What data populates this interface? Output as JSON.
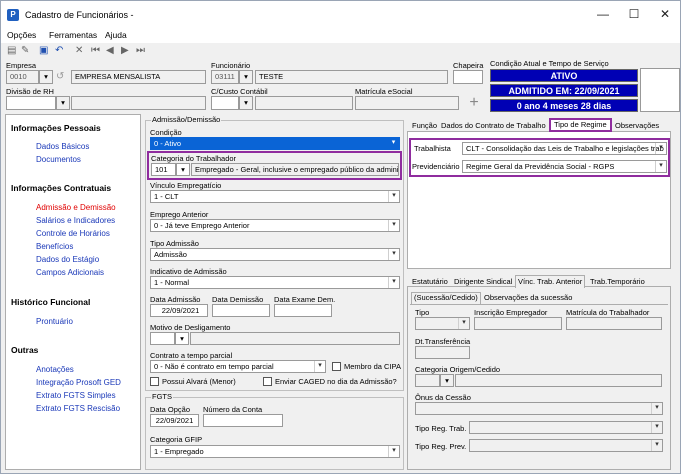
{
  "window": {
    "title": "Cadastro de Funcionários -",
    "min": "—",
    "max": "☐",
    "close": "✕"
  },
  "menu": [
    "Opções",
    "Ferramentas",
    "Ajuda"
  ],
  "top": {
    "empresa_label": "Empresa",
    "empresa_code": "0010",
    "empresa_name": "EMPRESA MENSALISTA",
    "funcionario_label": "Funcionário",
    "funcionario_code": "03111",
    "funcionario_name": "TESTE",
    "chapeira_label": "Chapeira",
    "condicao_label": "Condição Atual e Tempo de Serviço",
    "status1": "ATIVO",
    "status2": "ADMITIDO EM: 22/09/2021",
    "status3": "0 ano 4 meses 28 dias",
    "divisao_label": "Divisão de RH",
    "ccusto_label": "C/Custo Contábil",
    "matricula_label": "Matrícula eSocial"
  },
  "left": {
    "h1": "Informações Pessoais",
    "items1": [
      "Dados Básicos",
      "Documentos"
    ],
    "h2": "Informações Contratuais",
    "items2": [
      "Admissão e Demissão",
      "Salários e Indicadores",
      "Controle de Horários",
      "Benefícios",
      "Dados do Estágio",
      "Campos Adicionais"
    ],
    "h3": "Histórico Funcional",
    "items3": [
      "Prontuário"
    ],
    "h4": "Outras",
    "items4": [
      "Anotações",
      "Integração Prosoft GED",
      "Extrato FGTS Simples",
      "Extrato FGTS Rescisão"
    ]
  },
  "adm": {
    "group": "Admissão/Demissão",
    "condicao_label": "Condição",
    "condicao": "0 - Ativo",
    "categoria_label": "Categoria do Trabalhador",
    "categoria_code": "101",
    "categoria_desc": "Empregado - Geral, inclusive o empregado público da administ",
    "vinculo_label": "Vínculo Empregatício",
    "vinculo": "1 - CLT",
    "emprego_label": "Emprego Anterior",
    "emprego": "0 - Já teve Emprego Anterior",
    "tipoadm_label": "Tipo Admissão",
    "tipoadm": "Admissão",
    "indicativo_label": "Indicativo de Admissão",
    "indicativo": "1 - Normal",
    "data_adm_label": "Data Admissão",
    "data_adm": "22/09/2021",
    "data_dem_label": "Data Demissão",
    "data_exame_label": "Data Exame Dem.",
    "motivo_label": "Motivo de Desligamento",
    "contrato_label": "Contrato a tempo parcial",
    "contrato": "0 - Não é contrato em tempo parcial",
    "membro_cipa": "Membro da CIPA",
    "possui_alvara": "Possui Alvará (Menor)",
    "enviar_caged": "Enviar CAGED no dia da Admissão?"
  },
  "fgts": {
    "group": "FGTS",
    "data_opcao_label": "Data Opção",
    "data_opcao": "22/09/2021",
    "numero_conta_label": "Número da Conta",
    "categoria_gfip_label": "Categoria GFIP",
    "categoria_gfip": "1 - Empregado"
  },
  "tabs1": [
    "Função",
    "Dados do Contrato de Trabalho",
    "Tipo de Regime",
    "Observações"
  ],
  "regime": {
    "trab_label": "Trabalhista",
    "trab": "CLT - Consolidação das Leis de Trabalho e legislações trab",
    "prev_label": "Previdenciário",
    "prev": "Regime Geral da Previdência Social - RGPS"
  },
  "tabs2": [
    "Estatutário",
    "Dirigente Sindical",
    "Vínc. Trab. Anterior",
    "Trab.Temporário"
  ],
  "subtabs": [
    "(Sucessão/Cedido)",
    "Observações da sucessão"
  ],
  "vinc": {
    "tipo_label": "Tipo",
    "inscricao_label": "Inscrição Empregador",
    "matricula_label": "Matrícula do Trabalhador",
    "dt_transf_label": "Dt.Transferência",
    "cat_origem_label": "Categoria Origem/Cedido",
    "onus_label": "Ônus da Cessão",
    "tipo_reg_trab_label": "Tipo Reg. Trab.",
    "tipo_reg_prev_label": "Tipo Reg. Prev."
  }
}
